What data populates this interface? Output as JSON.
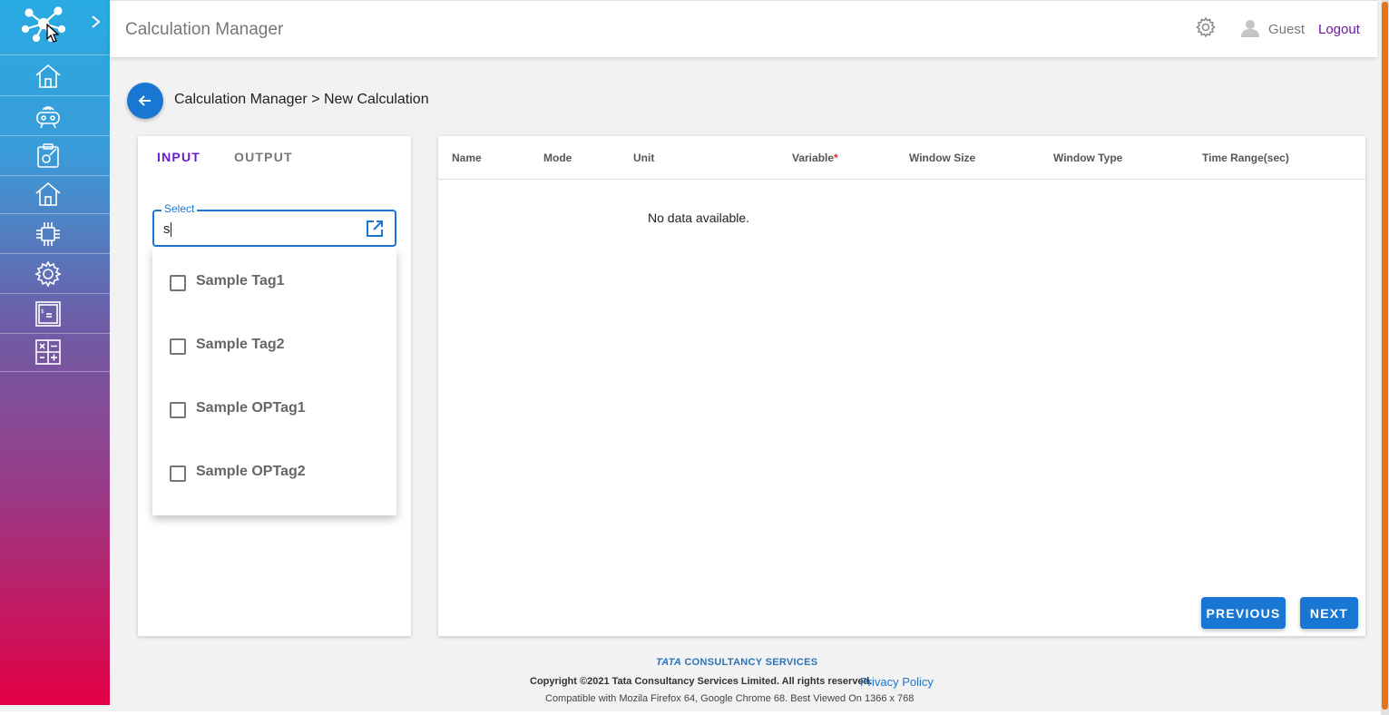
{
  "app": {
    "title": "Calculation Manager",
    "user_name": "Guest",
    "logout_label": "Logout"
  },
  "sidebar": {
    "items": [
      {
        "icon": "home-icon"
      },
      {
        "icon": "robot-icon"
      },
      {
        "icon": "edit-settings-icon"
      },
      {
        "icon": "home-icon"
      },
      {
        "icon": "chip-icon"
      },
      {
        "icon": "gear-wrench-icon"
      },
      {
        "icon": "terminal-icon"
      },
      {
        "icon": "calculator-icon"
      }
    ]
  },
  "breadcrumb": "Calculation Manager > New Calculation",
  "tabs": {
    "input": "INPUT",
    "output": "OUTPUT",
    "active": "INPUT"
  },
  "select": {
    "label": "Select",
    "value": "s"
  },
  "dropdown": {
    "options": [
      {
        "label": "Sample Tag1",
        "checked": false
      },
      {
        "label": "Sample Tag2",
        "checked": false
      },
      {
        "label": "Sample OPTag1",
        "checked": false
      },
      {
        "label": "Sample OPTag2",
        "checked": false
      }
    ]
  },
  "table": {
    "columns": [
      "Name",
      "Mode",
      "Unit",
      "Variable",
      "Window Size",
      "Window Type",
      "Time Range(sec)"
    ],
    "required_marker": "*",
    "empty_text": "No data available."
  },
  "buttons": {
    "previous": "PREVIOUS",
    "next": "NEXT"
  },
  "footer": {
    "brand_tata": "TATA",
    "brand_rest": "CONSULTANCY SERVICES",
    "copyright": "Copyright ©2021 Tata Consultancy Services Limited. All rights reserved.",
    "privacy": "Privacy Policy",
    "compat": "Compatible with Mozila Firefox 64, Google Chrome 68. Best Viewed On 1366 x 768"
  },
  "colors": {
    "primary": "#1976d2",
    "tab_active": "#6a1bd4",
    "logout": "#6a1b9a",
    "sidebar_top": "#29abe2",
    "sidebar_bottom": "#e30045"
  }
}
